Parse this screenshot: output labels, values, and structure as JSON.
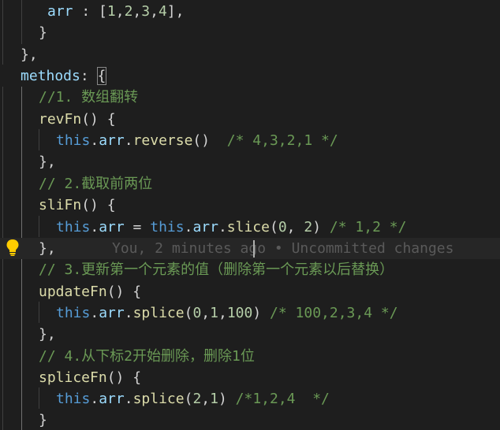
{
  "code_lines": [
    {
      "t1": "arr",
      "t2": " : [",
      "n1": "1",
      "s1": ",",
      "n2": "2",
      "s2": ",",
      "n3": "3",
      "s3": ",",
      "n4": "4",
      "t3": "],"
    },
    {
      "text": "}"
    },
    {
      "text": "},"
    },
    {
      "name": "methods",
      "rest": ": ",
      "brace": "{"
    },
    {
      "comment": "//1. 数组翻转"
    },
    {
      "fn": "revFn",
      "rest": "() {"
    },
    {
      "kw": "this",
      "dot1": ".",
      "prop": "arr",
      "dot2": ".",
      "fn": "reverse",
      "rest": "()  ",
      "comment": "/* 4,3,2,1 */"
    },
    {
      "text": "},"
    },
    {
      "comment": "// 2.截取前两位"
    },
    {
      "fn": "sliFn",
      "rest": "() {"
    },
    {
      "kw": "this",
      "dot1": ".",
      "prop": "arr",
      "eq": " = ",
      "kw2": "this",
      "dot2": ".",
      "prop2": "arr",
      "dot3": ".",
      "fn": "slice",
      "p1": "(",
      "n1": "0",
      "sep": ", ",
      "n2": "2",
      "p2": ") ",
      "comment": "/* 1,2 */"
    },
    {
      "text": "},",
      "blame": "You, 2 minutes ago • Uncommitted changes"
    },
    {
      "comment": "// 3.更新第一个元素的值（删除第一个元素以后替换）"
    },
    {
      "fn": "updateFn",
      "rest": "() {"
    },
    {
      "kw": "this",
      "dot1": ".",
      "prop": "arr",
      "dot2": ".",
      "fn": "splice",
      "p1": "(",
      "n1": "0",
      "s1": ",",
      "n2": "1",
      "s2": ",",
      "n3": "100",
      "p2": ") ",
      "comment": "/* 100,2,3,4 */"
    },
    {
      "text": "},"
    },
    {
      "comment": "// 4.从下标2开始删除，删除1位"
    },
    {
      "fn": "spliceFn",
      "rest": "() {"
    },
    {
      "kw": "this",
      "dot1": ".",
      "prop": "arr",
      "dot2": ".",
      "fn": "splice",
      "p1": "(",
      "n1": "2",
      "s1": ",",
      "n2": "1",
      "p2": ") ",
      "comment": "/*1,2,4  */"
    },
    {
      "text": "}"
    }
  ],
  "icons": {
    "lightbulb": "lightbulb-icon"
  },
  "colors": {
    "background": "#1e1e1e",
    "keyword": "#569cd6",
    "property": "#9cdcfe",
    "function": "#dcdcaa",
    "number": "#b5cea8",
    "comment": "#6a9955",
    "lightbulb": "#ffcc00"
  }
}
